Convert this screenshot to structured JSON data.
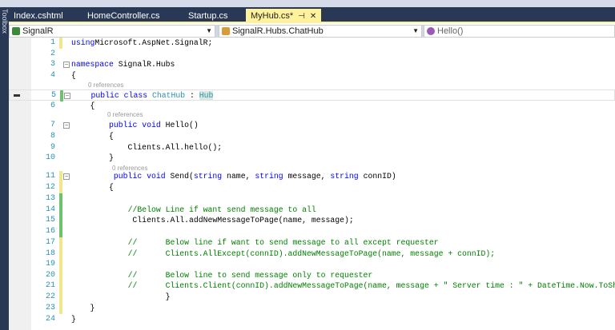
{
  "toolbox_label": "Toolbox",
  "tabs": [
    {
      "label": "Index.cshtml"
    },
    {
      "label": "HomeController.cs"
    },
    {
      "label": "Startup.cs"
    },
    {
      "label": "MyHub.cs*",
      "active": true
    }
  ],
  "nav": {
    "project": "SignalR",
    "type": "SignalR.Hubs.ChatHub",
    "member": "Hello()"
  },
  "codelens": "0 references",
  "lines": [
    {
      "n": "1",
      "segs": [
        [
          "kw",
          "using"
        ],
        [
          "",
          "Microsoft.AspNet.SignalR;"
        ]
      ]
    },
    {
      "n": "2",
      "segs": []
    },
    {
      "n": "3",
      "segs": [
        [
          "kw",
          "namespace"
        ],
        [
          "",
          " SignalR.Hubs"
        ]
      ]
    },
    {
      "n": "4",
      "segs": [
        [
          "",
          "{"
        ]
      ]
    },
    {
      "n": "5",
      "segs": [
        [
          "",
          "    "
        ],
        [
          "kw",
          "public class "
        ],
        [
          "ty",
          "ChatHub"
        ],
        [
          "",
          " : "
        ],
        [
          "ty hub",
          "Hub"
        ]
      ]
    },
    {
      "n": "6",
      "segs": [
        [
          "",
          "    {"
        ]
      ]
    },
    {
      "n": "7",
      "segs": [
        [
          "",
          "        "
        ],
        [
          "kw",
          "public void "
        ],
        [
          "",
          "Hello()"
        ]
      ]
    },
    {
      "n": "8",
      "segs": [
        [
          "",
          "        {"
        ]
      ]
    },
    {
      "n": "9",
      "segs": [
        [
          "",
          "            Clients.All.hello();"
        ]
      ]
    },
    {
      "n": "10",
      "segs": [
        [
          "",
          "        }"
        ]
      ]
    },
    {
      "n": "11",
      "segs": [
        [
          "",
          "         "
        ],
        [
          "kw",
          "public void "
        ],
        [
          "",
          "Send("
        ],
        [
          "kw",
          "string"
        ],
        [
          "",
          " name, "
        ],
        [
          "kw",
          "string"
        ],
        [
          "",
          " message, "
        ],
        [
          "kw",
          "string"
        ],
        [
          "",
          " connID)"
        ]
      ]
    },
    {
      "n": "12",
      "segs": [
        [
          "",
          "        {"
        ]
      ]
    },
    {
      "n": "13",
      "segs": []
    },
    {
      "n": "14",
      "segs": [
        [
          "",
          "            "
        ],
        [
          "cm",
          "//Below Line if want send message to all"
        ]
      ]
    },
    {
      "n": "15",
      "segs": [
        [
          "",
          "             Clients.All.addNewMessageToPage(name, message);"
        ]
      ]
    },
    {
      "n": "16",
      "segs": []
    },
    {
      "n": "17",
      "segs": [
        [
          "",
          "            "
        ],
        [
          "cm",
          "//      Below line if want to send message to all except requester"
        ]
      ]
    },
    {
      "n": "18",
      "segs": [
        [
          "",
          "            "
        ],
        [
          "cm",
          "//      Clients.AllExcept(connID).addNewMessageToPage(name, message + connID);"
        ]
      ]
    },
    {
      "n": "19",
      "segs": []
    },
    {
      "n": "20",
      "segs": [
        [
          "",
          "            "
        ],
        [
          "cm",
          "//      Below line to send message only to requester"
        ]
      ]
    },
    {
      "n": "21",
      "segs": [
        [
          "",
          "            "
        ],
        [
          "cm",
          "//      Clients.Client(connID).addNewMessageToPage(name, message + \" Server time : \" + DateTime.Now.ToSh"
        ]
      ]
    },
    {
      "n": "22",
      "segs": [
        [
          "",
          "                    }"
        ]
      ]
    },
    {
      "n": "23",
      "segs": [
        [
          "",
          "    }"
        ]
      ]
    },
    {
      "n": "24",
      "segs": [
        [
          "",
          "}"
        ]
      ]
    }
  ],
  "colors": {
    "tabbar": "#293955",
    "active_tab": "#fff29d",
    "keyword": "#0000ff",
    "type": "#2b91af",
    "comment": "#008000",
    "green_change": "#6cc36c",
    "yellow_change": "#f0e68c"
  }
}
